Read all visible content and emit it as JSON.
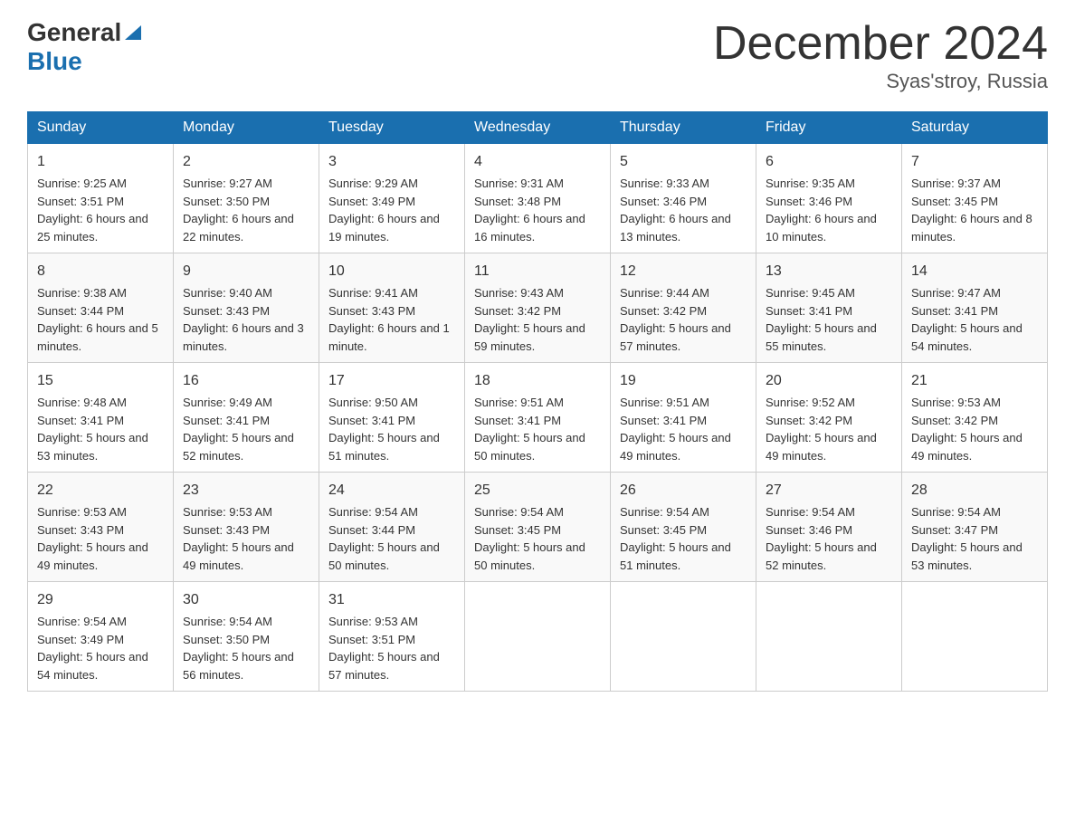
{
  "logo": {
    "general": "General",
    "arrow": "▲",
    "blue": "Blue"
  },
  "title": "December 2024",
  "location": "Syas'stroy, Russia",
  "weekdays": [
    "Sunday",
    "Monday",
    "Tuesday",
    "Wednesday",
    "Thursday",
    "Friday",
    "Saturday"
  ],
  "weeks": [
    [
      {
        "day": "1",
        "sunrise": "9:25 AM",
        "sunset": "3:51 PM",
        "daylight": "6 hours and 25 minutes."
      },
      {
        "day": "2",
        "sunrise": "9:27 AM",
        "sunset": "3:50 PM",
        "daylight": "6 hours and 22 minutes."
      },
      {
        "day": "3",
        "sunrise": "9:29 AM",
        "sunset": "3:49 PM",
        "daylight": "6 hours and 19 minutes."
      },
      {
        "day": "4",
        "sunrise": "9:31 AM",
        "sunset": "3:48 PM",
        "daylight": "6 hours and 16 minutes."
      },
      {
        "day": "5",
        "sunrise": "9:33 AM",
        "sunset": "3:46 PM",
        "daylight": "6 hours and 13 minutes."
      },
      {
        "day": "6",
        "sunrise": "9:35 AM",
        "sunset": "3:46 PM",
        "daylight": "6 hours and 10 minutes."
      },
      {
        "day": "7",
        "sunrise": "9:37 AM",
        "sunset": "3:45 PM",
        "daylight": "6 hours and 8 minutes."
      }
    ],
    [
      {
        "day": "8",
        "sunrise": "9:38 AM",
        "sunset": "3:44 PM",
        "daylight": "6 hours and 5 minutes."
      },
      {
        "day": "9",
        "sunrise": "9:40 AM",
        "sunset": "3:43 PM",
        "daylight": "6 hours and 3 minutes."
      },
      {
        "day": "10",
        "sunrise": "9:41 AM",
        "sunset": "3:43 PM",
        "daylight": "6 hours and 1 minute."
      },
      {
        "day": "11",
        "sunrise": "9:43 AM",
        "sunset": "3:42 PM",
        "daylight": "5 hours and 59 minutes."
      },
      {
        "day": "12",
        "sunrise": "9:44 AM",
        "sunset": "3:42 PM",
        "daylight": "5 hours and 57 minutes."
      },
      {
        "day": "13",
        "sunrise": "9:45 AM",
        "sunset": "3:41 PM",
        "daylight": "5 hours and 55 minutes."
      },
      {
        "day": "14",
        "sunrise": "9:47 AM",
        "sunset": "3:41 PM",
        "daylight": "5 hours and 54 minutes."
      }
    ],
    [
      {
        "day": "15",
        "sunrise": "9:48 AM",
        "sunset": "3:41 PM",
        "daylight": "5 hours and 53 minutes."
      },
      {
        "day": "16",
        "sunrise": "9:49 AM",
        "sunset": "3:41 PM",
        "daylight": "5 hours and 52 minutes."
      },
      {
        "day": "17",
        "sunrise": "9:50 AM",
        "sunset": "3:41 PM",
        "daylight": "5 hours and 51 minutes."
      },
      {
        "day": "18",
        "sunrise": "9:51 AM",
        "sunset": "3:41 PM",
        "daylight": "5 hours and 50 minutes."
      },
      {
        "day": "19",
        "sunrise": "9:51 AM",
        "sunset": "3:41 PM",
        "daylight": "5 hours and 49 minutes."
      },
      {
        "day": "20",
        "sunrise": "9:52 AM",
        "sunset": "3:42 PM",
        "daylight": "5 hours and 49 minutes."
      },
      {
        "day": "21",
        "sunrise": "9:53 AM",
        "sunset": "3:42 PM",
        "daylight": "5 hours and 49 minutes."
      }
    ],
    [
      {
        "day": "22",
        "sunrise": "9:53 AM",
        "sunset": "3:43 PM",
        "daylight": "5 hours and 49 minutes."
      },
      {
        "day": "23",
        "sunrise": "9:53 AM",
        "sunset": "3:43 PM",
        "daylight": "5 hours and 49 minutes."
      },
      {
        "day": "24",
        "sunrise": "9:54 AM",
        "sunset": "3:44 PM",
        "daylight": "5 hours and 50 minutes."
      },
      {
        "day": "25",
        "sunrise": "9:54 AM",
        "sunset": "3:45 PM",
        "daylight": "5 hours and 50 minutes."
      },
      {
        "day": "26",
        "sunrise": "9:54 AM",
        "sunset": "3:45 PM",
        "daylight": "5 hours and 51 minutes."
      },
      {
        "day": "27",
        "sunrise": "9:54 AM",
        "sunset": "3:46 PM",
        "daylight": "5 hours and 52 minutes."
      },
      {
        "day": "28",
        "sunrise": "9:54 AM",
        "sunset": "3:47 PM",
        "daylight": "5 hours and 53 minutes."
      }
    ],
    [
      {
        "day": "29",
        "sunrise": "9:54 AM",
        "sunset": "3:49 PM",
        "daylight": "5 hours and 54 minutes."
      },
      {
        "day": "30",
        "sunrise": "9:54 AM",
        "sunset": "3:50 PM",
        "daylight": "5 hours and 56 minutes."
      },
      {
        "day": "31",
        "sunrise": "9:53 AM",
        "sunset": "3:51 PM",
        "daylight": "5 hours and 57 minutes."
      },
      null,
      null,
      null,
      null
    ]
  ]
}
